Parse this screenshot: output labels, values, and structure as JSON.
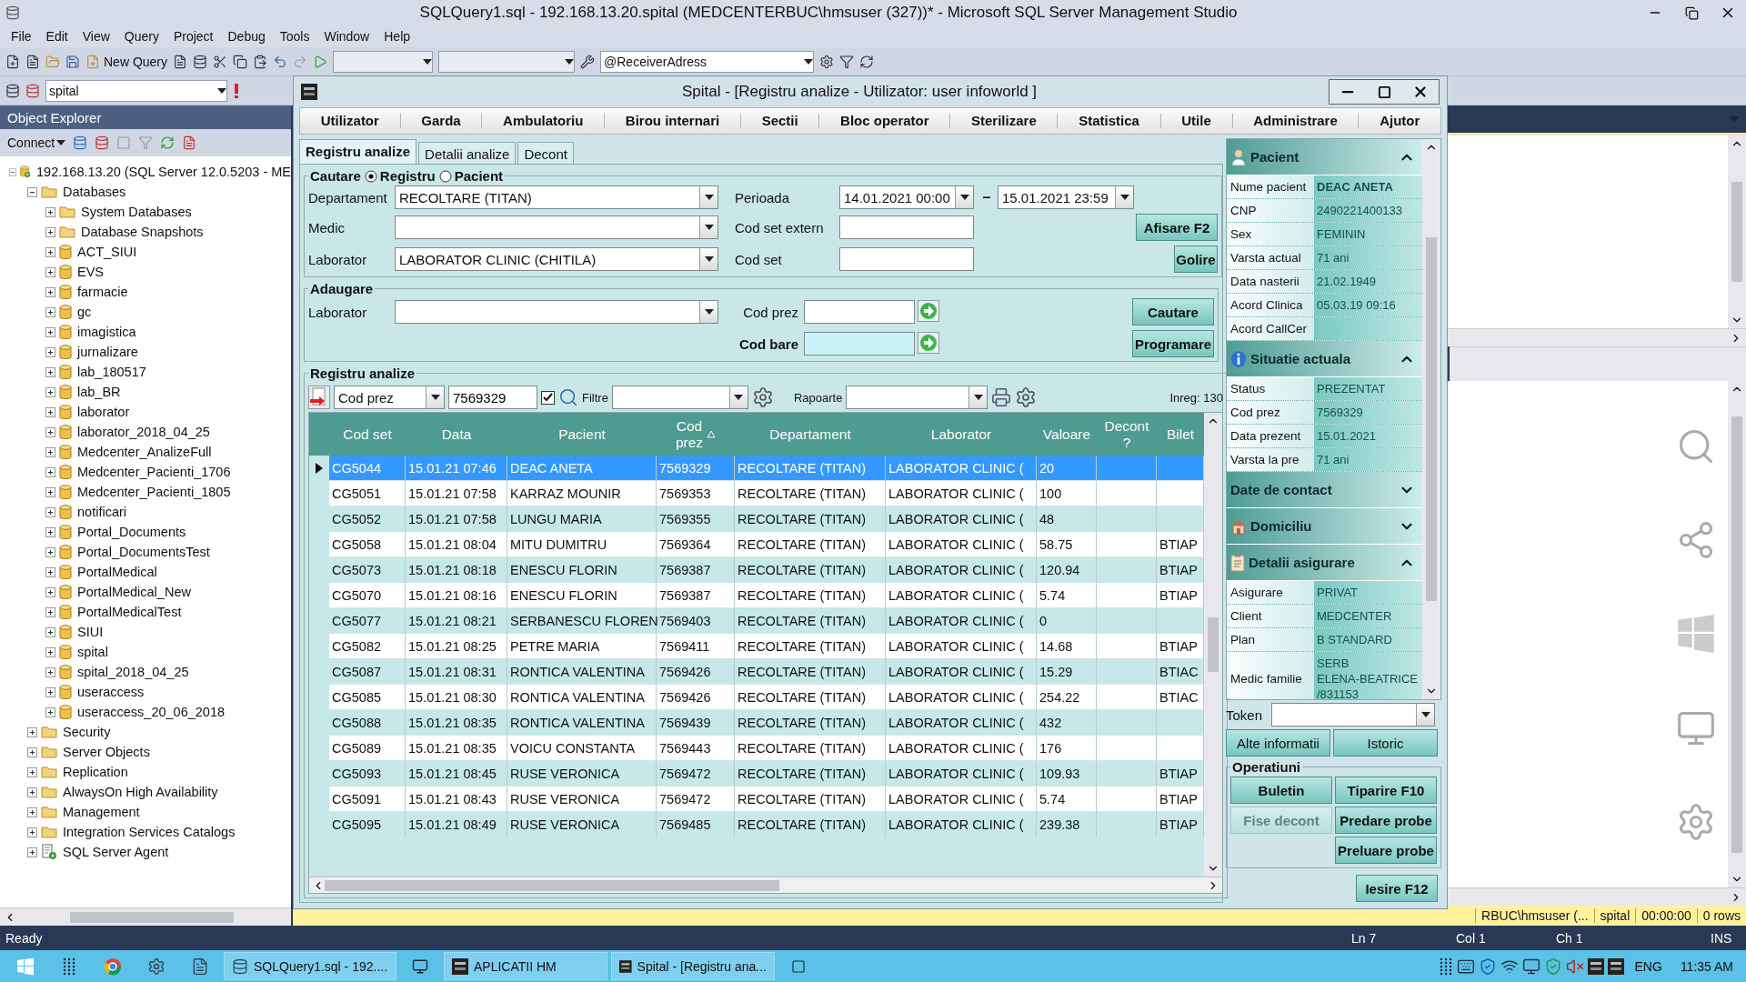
{
  "window": {
    "title": "SQLQuery1.sql - 192.168.13.20.spital (MEDCENTERBUC\\hmsuser (327))* - Microsoft SQL Server Management Studio"
  },
  "menu": [
    "File",
    "Edit",
    "View",
    "Query",
    "Project",
    "Debug",
    "Tools",
    "Window",
    "Help"
  ],
  "toolbar": {
    "new_query": "New Query",
    "receiver": "@ReceiverAdress",
    "database": "spital"
  },
  "object_explorer": {
    "title": "Object Explorer",
    "connect": "Connect",
    "tree": [
      {
        "label": "192.168.13.20 (SQL Server 12.0.5203 - ME",
        "kind": "server",
        "expanded": true,
        "children": [
          {
            "label": "Databases",
            "kind": "folder",
            "expanded": true,
            "children": [
              {
                "label": "System Databases",
                "kind": "folder",
                "expanded": false
              },
              {
                "label": "Database Snapshots",
                "kind": "folder",
                "expanded": false
              },
              {
                "label": "ACT_SIUI",
                "kind": "database",
                "expanded": false
              },
              {
                "label": "EVS",
                "kind": "database",
                "expanded": false
              },
              {
                "label": "farmacie",
                "kind": "database",
                "expanded": false
              },
              {
                "label": "gc",
                "kind": "database",
                "expanded": false
              },
              {
                "label": "imagistica",
                "kind": "database",
                "expanded": false
              },
              {
                "label": "jurnalizare",
                "kind": "database",
                "expanded": false
              },
              {
                "label": "lab_180517",
                "kind": "database",
                "expanded": false
              },
              {
                "label": "lab_BR",
                "kind": "database",
                "expanded": false
              },
              {
                "label": "laborator",
                "kind": "database",
                "expanded": false
              },
              {
                "label": "laborator_2018_04_25",
                "kind": "database",
                "expanded": false
              },
              {
                "label": "Medcenter_AnalizeFull",
                "kind": "database",
                "expanded": false
              },
              {
                "label": "Medcenter_Pacienti_1706",
                "kind": "database",
                "expanded": false
              },
              {
                "label": "Medcenter_Pacienti_1805",
                "kind": "database",
                "expanded": false
              },
              {
                "label": "notificari",
                "kind": "database",
                "expanded": false
              },
              {
                "label": "Portal_Documents",
                "kind": "database",
                "expanded": false
              },
              {
                "label": "Portal_DocumentsTest",
                "kind": "database",
                "expanded": false
              },
              {
                "label": "PortalMedical",
                "kind": "database",
                "expanded": false
              },
              {
                "label": "PortalMedical_New",
                "kind": "database",
                "expanded": false
              },
              {
                "label": "PortalMedicalTest",
                "kind": "database",
                "expanded": false
              },
              {
                "label": "SIUI",
                "kind": "database",
                "expanded": false
              },
              {
                "label": "spital",
                "kind": "database",
                "expanded": false
              },
              {
                "label": "spital_2018_04_25",
                "kind": "database",
                "expanded": false
              },
              {
                "label": "useraccess",
                "kind": "database",
                "expanded": false
              },
              {
                "label": "useraccess_20_06_2018",
                "kind": "database",
                "expanded": false
              }
            ]
          },
          {
            "label": "Security",
            "kind": "folder",
            "expanded": false
          },
          {
            "label": "Server Objects",
            "kind": "folder",
            "expanded": false
          },
          {
            "label": "Replication",
            "kind": "folder",
            "expanded": false
          },
          {
            "label": "AlwaysOn High Availability",
            "kind": "folder",
            "expanded": false
          },
          {
            "label": "Management",
            "kind": "folder",
            "expanded": false
          },
          {
            "label": "Integration Services Catalogs",
            "kind": "folder",
            "expanded": false
          },
          {
            "label": "SQL Server Agent",
            "kind": "agent",
            "expanded": false
          }
        ]
      }
    ]
  },
  "app": {
    "title": "Spital - [Registru analize - Utilizator: user infoworld ]",
    "menu": [
      "Utilizator",
      "Garda",
      "Ambulatoriu",
      "Birou internari",
      "Sectii",
      "Bloc operator",
      "Sterilizare",
      "Statistica",
      "Utile",
      "Administrare",
      "Ajutor"
    ],
    "tabs": [
      {
        "label": "Registru analize",
        "selected": true
      },
      {
        "label": "Detalii analize",
        "selected": false
      },
      {
        "label": "Decont",
        "selected": false
      }
    ],
    "search": {
      "legend": "Cautare",
      "modes": [
        {
          "label": "Registru",
          "selected": true
        },
        {
          "label": "Pacient",
          "selected": false
        }
      ],
      "departament": {
        "label": "Departament",
        "value": "RECOLTARE (TITAN)"
      },
      "medic": {
        "label": "Medic"
      },
      "laborator": {
        "label": "Laborator",
        "value": "LABORATOR CLINIC (CHITILA)"
      },
      "perioada": {
        "label": "Perioada",
        "from": "14.01.2021 00:00",
        "to": "15.01.2021 23:59",
        "separator": "–"
      },
      "cod_set_extern": {
        "label": "Cod set extern"
      },
      "cod_set": {
        "label": "Cod set"
      },
      "buttons": [
        "Afisare F2",
        "Golire"
      ]
    },
    "add": {
      "legend": "Adaugare",
      "laborator": {
        "label": "Laborator"
      },
      "cod_prez": {
        "label": "Cod prez"
      },
      "cod_bare": {
        "label": "Cod bare"
      },
      "buttons": [
        "Cautare",
        "Programare"
      ]
    },
    "registry": {
      "legend": "Registru analize",
      "field": "Cod prez",
      "value": "7569329",
      "checked": true,
      "filter_label": "Filtre",
      "reports_label": "Rapoarte",
      "count": "Inreg: 130",
      "columns": [
        {
          "label": "Cod set",
          "sorted": false
        },
        {
          "label": "Data",
          "sorted": false
        },
        {
          "label": "Pacient",
          "sorted": false
        },
        {
          "label": "Cod\nprez",
          "sorted": true
        },
        {
          "label": "Departament",
          "sorted": false
        },
        {
          "label": "Laborator",
          "sorted": false
        },
        {
          "label": "Valoare",
          "sorted": false
        },
        {
          "label": "Decont\n?",
          "sorted": false
        },
        {
          "label": "Bilet",
          "sorted": false
        }
      ],
      "rows": [
        {
          "selected": true,
          "cells": [
            "CG5044",
            "15.01.21 07:46",
            "DEAC ANETA",
            "7569329",
            "RECOLTARE (TITAN)",
            "LABORATOR CLINIC (",
            "20"
          ]
        },
        {
          "selected": false,
          "cells": [
            "CG5051",
            "15.01.21 07:58",
            "KARRAZ MOUNIR",
            "7569353",
            "RECOLTARE (TITAN)",
            "LABORATOR CLINIC (",
            "100"
          ]
        },
        {
          "selected": false,
          "cells": [
            "CG5052",
            "15.01.21 07:58",
            "LUNGU MARIA",
            "7569355",
            "RECOLTARE (TITAN)",
            "LABORATOR CLINIC (",
            "48"
          ]
        },
        {
          "selected": false,
          "cells": [
            "CG5058",
            "15.01.21 08:04",
            "MITU DUMITRU",
            "7569364",
            "RECOLTARE (TITAN)",
            "LABORATOR CLINIC (",
            "58.75"
          ],
          "bilet": "BTIAP"
        },
        {
          "selected": false,
          "cells": [
            "CG5073",
            "15.01.21 08:18",
            "ENESCU FLORIN",
            "7569387",
            "RECOLTARE (TITAN)",
            "LABORATOR CLINIC (",
            "120.94"
          ],
          "bilet": "BTIAP"
        },
        {
          "selected": false,
          "cells": [
            "CG5070",
            "15.01.21 08:16",
            "ENESCU FLORIN",
            "7569387",
            "RECOLTARE (TITAN)",
            "LABORATOR CLINIC (",
            "5.74"
          ],
          "bilet": "BTIAP"
        },
        {
          "selected": false,
          "cells": [
            "CG5077",
            "15.01.21 08:21",
            "SERBANESCU FLOREN",
            "7569403",
            "RECOLTARE (TITAN)",
            "LABORATOR CLINIC (",
            "0"
          ]
        },
        {
          "selected": false,
          "cells": [
            "CG5082",
            "15.01.21 08:25",
            "PETRE MARIA",
            "7569411",
            "RECOLTARE (TITAN)",
            "LABORATOR CLINIC (",
            "14.68"
          ],
          "bilet": "BTIAP"
        },
        {
          "selected": false,
          "cells": [
            "CG5087",
            "15.01.21 08:31",
            "RONTICA VALENTINA",
            "7569426",
            "RECOLTARE (TITAN)",
            "LABORATOR CLINIC (",
            "15.29"
          ],
          "bilet": "BTIAC"
        },
        {
          "selected": false,
          "cells": [
            "CG5085",
            "15.01.21 08:30",
            "RONTICA VALENTINA",
            "7569426",
            "RECOLTARE (TITAN)",
            "LABORATOR CLINIC (",
            "254.22"
          ],
          "bilet": "BTIAC"
        },
        {
          "selected": false,
          "cells": [
            "CG5088",
            "15.01.21 08:35",
            "RONTICA VALENTINA",
            "7569439",
            "RECOLTARE (TITAN)",
            "LABORATOR CLINIC (",
            "432"
          ]
        },
        {
          "selected": false,
          "cells": [
            "CG5089",
            "15.01.21 08:35",
            "VOICU CONSTANTA",
            "7569443",
            "RECOLTARE (TITAN)",
            "LABORATOR CLINIC (",
            "176"
          ]
        },
        {
          "selected": false,
          "cells": [
            "CG5093",
            "15.01.21 08:45",
            "RUSE VERONICA",
            "7569472",
            "RECOLTARE (TITAN)",
            "LABORATOR CLINIC (",
            "109.93"
          ],
          "bilet": "BTIAP"
        },
        {
          "selected": false,
          "cells": [
            "CG5091",
            "15.01.21 08:43",
            "RUSE VERONICA",
            "7569472",
            "RECOLTARE (TITAN)",
            "LABORATOR CLINIC (",
            "5.74"
          ],
          "bilet": "BTIAP"
        },
        {
          "selected": false,
          "cells": [
            "CG5095",
            "15.01.21 08:49",
            "RUSE VERONICA",
            "7569485",
            "RECOLTARE (TITAN)",
            "LABORATOR CLINIC (",
            "239.38"
          ],
          "bilet": "BTIAP"
        }
      ]
    },
    "patient_panel": {
      "sections": [
        {
          "title": "Pacient",
          "expanded": true,
          "fields": [
            {
              "label": "Nume pacient",
              "value": "DEAC ANETA",
              "bold": true
            },
            {
              "label": "CNP",
              "value": "2490221400133",
              "bold": false
            },
            {
              "label": "Sex",
              "value": "FEMININ",
              "bold": false
            },
            {
              "label": "Varsta actual",
              "value": "71 ani",
              "bold": false
            },
            {
              "label": "Data nasterii",
              "value": "21.02.1949",
              "bold": false
            },
            {
              "label": "Acord Clinica",
              "value": "05.03.19 09:16",
              "bold": false
            },
            {
              "label": "Acord CallCer",
              "bold": false
            }
          ]
        },
        {
          "title": "Situatie actuala",
          "expanded": true,
          "fields": [
            {
              "label": "Status",
              "value": "PREZENTAT",
              "bold": false
            },
            {
              "label": "Cod prez",
              "value": "7569329",
              "bold": false
            },
            {
              "label": "Data prezent",
              "value": "15.01.2021",
              "bold": false
            },
            {
              "label": "Varsta la pre",
              "value": "71 ani",
              "bold": false
            }
          ]
        },
        {
          "title": "Date de contact",
          "expanded": false
        },
        {
          "title": "Domiciliu",
          "expanded": false
        },
        {
          "title": "Detalii asigurare",
          "expanded": true,
          "fields": [
            {
              "label": "Asigurare",
              "value": "PRIVAT",
              "bold": false
            },
            {
              "label": "Client",
              "value": "MEDCENTER",
              "bold": false
            },
            {
              "label": "Plan",
              "value": "B STANDARD",
              "bold": false
            },
            {
              "label": "Medic familie",
              "value": "SERB\nELENA-BEATRICE\n/831153",
              "bold": false
            }
          ]
        }
      ],
      "token": {
        "label": "Token"
      },
      "buttons": [
        "Alte informatii",
        "Istoric"
      ],
      "operations": {
        "legend": "Operatiuni",
        "left": [
          {
            "label": "Buletin",
            "disabled": false
          },
          {
            "label": "Fise decont",
            "disabled": true
          }
        ],
        "right": [
          {
            "label": "Tiparire F10",
            "disabled": false
          },
          {
            "label": "Predare probe",
            "disabled": false
          },
          {
            "label": "Preluare probe",
            "disabled": false
          }
        ]
      },
      "exit": "Iesire F12"
    }
  },
  "editor": {
    "status": [
      "RBUC\\hmsuser (...",
      "spital",
      "00:00:00",
      "0 rows"
    ]
  },
  "status_bar": {
    "ready": "Ready",
    "ln": "Ln 7",
    "col": "Col 1",
    "ch": "Ch 1",
    "mode": "INS"
  },
  "taskbar": {
    "tasks": [
      {
        "label": "SQLQuery1.sql - 192...."
      },
      {
        "label": "APLICATII HM"
      },
      {
        "label": "Spital - [Registru ana..."
      }
    ],
    "lang": "ENG",
    "time": "11:35 AM"
  }
}
